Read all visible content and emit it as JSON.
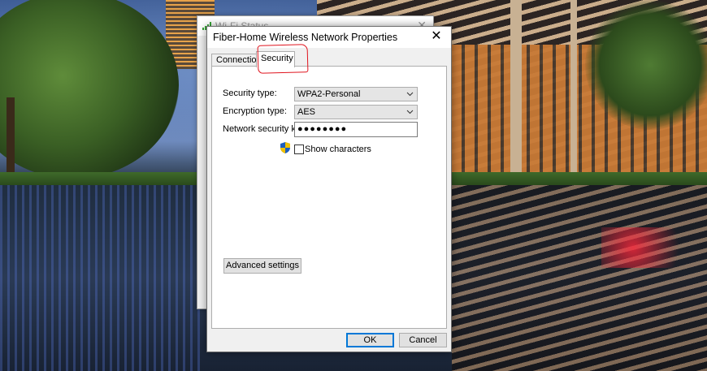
{
  "background_window": {
    "title": "Wi-Fi Status"
  },
  "dialog": {
    "title": "Fiber-Home Wireless Network Properties",
    "close_glyph": "✕",
    "tabs": [
      {
        "label": "Connection",
        "selected": false
      },
      {
        "label": "Security",
        "selected": true,
        "highlighted": true
      }
    ],
    "security": {
      "security_type_label": "Security type:",
      "security_type_value": "WPA2-Personal",
      "encryption_type_label": "Encryption type:",
      "encryption_type_value": "AES",
      "network_key_label": "Network security key",
      "network_key_value": "●●●●●●●●",
      "show_characters_label": "Show characters",
      "show_characters_checked": false,
      "advanced_settings_label": "Advanced settings"
    },
    "buttons": {
      "ok": "OK",
      "cancel": "Cancel"
    }
  },
  "colors": {
    "accent": "#0078d7",
    "highlight_circle": "#e0141e",
    "dialog_bg": "#f0f0f0",
    "panel_bg": "#ffffff"
  },
  "icons": {
    "wifi": "wifi-signal-icon",
    "shield": "uac-shield-icon",
    "close": "close-icon",
    "dropdown": "chevron-down-icon"
  }
}
